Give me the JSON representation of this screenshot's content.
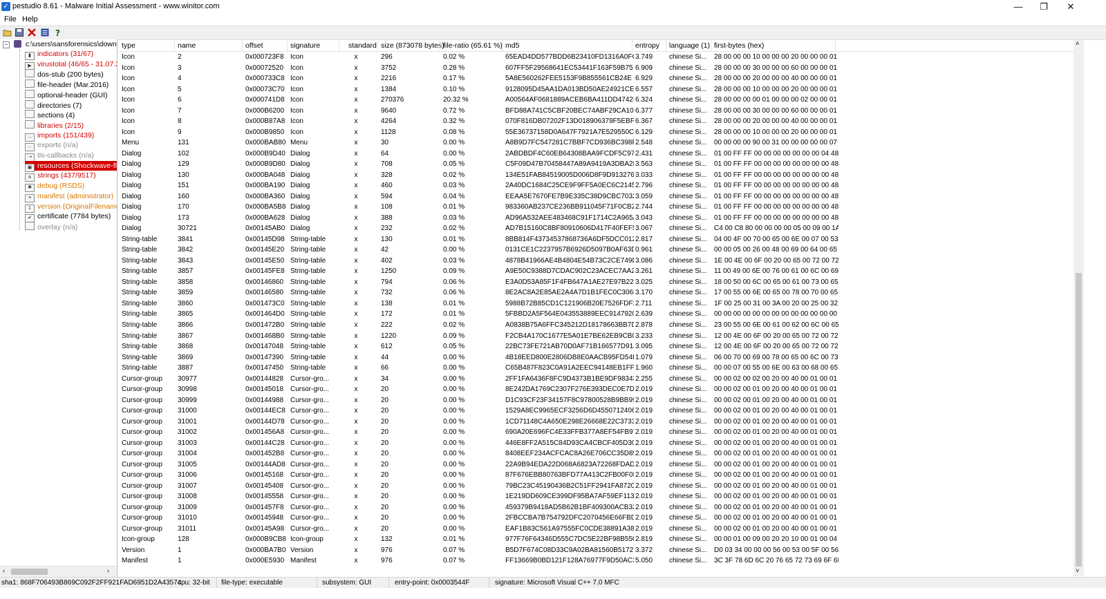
{
  "window": {
    "title": "pestudio 8.61 - Malware Initial Assessment - www.winitor.com",
    "minimize": "—",
    "restore": "❐",
    "close": "✕"
  },
  "menu": {
    "file": "File",
    "help": "Help"
  },
  "toolbar": {
    "open": "open-icon",
    "save": "save-icon",
    "delete": "delete-icon",
    "list": "list-icon",
    "help": "help-icon"
  },
  "tree": {
    "root": "c:\\users\\sansforensics\\downlo",
    "items": [
      {
        "label": "indicators (31/67)",
        "style": "red",
        "icon": "chart-icon"
      },
      {
        "label": "virustotal (46/65 - 31.07.20",
        "style": "red",
        "icon": "virustotal-icon"
      },
      {
        "label": "dos-stub (200 bytes)",
        "style": "normal",
        "icon": "box-icon"
      },
      {
        "label": "file-header (Mar.2016)",
        "style": "normal",
        "icon": "box-icon"
      },
      {
        "label": "optional-header (GUI)",
        "style": "normal",
        "icon": "box-icon"
      },
      {
        "label": "directories (7)",
        "style": "normal",
        "icon": "box-icon"
      },
      {
        "label": "sections (4)",
        "style": "normal",
        "icon": "box-icon"
      },
      {
        "label": "libraries (2/15)",
        "style": "red",
        "icon": "box-icon"
      },
      {
        "label": "imports (151/439)",
        "style": "red",
        "icon": "import-icon"
      },
      {
        "label": "exports (n/a)",
        "style": "gray",
        "icon": "export-icon"
      },
      {
        "label": "tls-callbacks (n/a)",
        "style": "gray",
        "icon": "callback-icon"
      },
      {
        "label": "resources (Shockwave-flas",
        "style": "selected",
        "icon": "resource-icon"
      },
      {
        "label": "strings (437/9517)",
        "style": "red",
        "icon": "strings-icon"
      },
      {
        "label": "debug (RSDS)",
        "style": "orange",
        "icon": "debug-icon"
      },
      {
        "label": "manifest (administrator)",
        "style": "orange",
        "icon": "manifest-icon"
      },
      {
        "label": "version (OriginalFilename)",
        "style": "orange",
        "icon": "version-icon"
      },
      {
        "label": "certificate (7784 bytes)",
        "style": "normal",
        "icon": "certificate-icon"
      },
      {
        "label": "overlay (n/a)",
        "style": "gray",
        "icon": "overlay-icon"
      }
    ]
  },
  "columns": [
    "type",
    "name",
    "offset",
    "signature",
    "standard",
    "size (873078 bytes)",
    "file-ratio (65.61 %)",
    "md5",
    "entropy",
    "language (1)",
    "first-bytes (hex)"
  ],
  "rows": [
    [
      "Icon",
      "2",
      "0x000723F8",
      "Icon",
      "x",
      "296",
      "0.02 %",
      "65EAD4DD577BDD6B23410FD1316A0FC9",
      "3.749",
      "chinese Si...",
      "28 00 00 00 10 00 00 00 20 00 00 00 01 ..."
    ],
    [
      "Icon",
      "3",
      "0x00072520",
      "Icon",
      "x",
      "3752",
      "0.28 %",
      "607FF5F29568641EC53441F163F59B75",
      "6.909",
      "chinese Si...",
      "28 00 00 00 30 00 00 00 60 00 00 00 01 ..."
    ],
    [
      "Icon",
      "4",
      "0x000733C8",
      "Icon",
      "x",
      "2216",
      "0.17 %",
      "5A8E560262FEE5153F9B855561CB24E",
      "6.929",
      "chinese Si...",
      "28 00 00 00 20 00 00 00 40 00 00 00 01 ..."
    ],
    [
      "Icon",
      "5",
      "0x00073C70",
      "Icon",
      "x",
      "1384",
      "0.10 %",
      "9128095D45AA1DA013BD50AE24921CE7",
      "6.557",
      "chinese Si...",
      "28 00 00 00 10 00 00 00 20 00 00 00 01 ..."
    ],
    [
      "Icon",
      "6",
      "0x000741D8",
      "Icon",
      "x",
      "270376",
      "20.32 %",
      "A00564AF0681889ACEB6BA411DD4742B",
      "6.324",
      "chinese Si...",
      "28 00 00 00 00 01 00 00 00 02 00 00 01 ..."
    ],
    [
      "Icon",
      "7",
      "0x000B6200",
      "Icon",
      "x",
      "9640",
      "0.72 %",
      "BFD88A741C5CBF20BEC74ABF29CA10D7",
      "6.377",
      "chinese Si...",
      "28 00 00 00 30 00 00 00 60 00 00 00 01 ..."
    ],
    [
      "Icon",
      "8",
      "0x000B87A8",
      "Icon",
      "x",
      "4264",
      "0.32 %",
      "070F816DB07202F13D018906379F5EBF",
      "6.367",
      "chinese Si...",
      "28 00 00 00 20 00 00 00 40 00 00 00 01 ..."
    ],
    [
      "Icon",
      "9",
      "0x000B9850",
      "Icon",
      "x",
      "1128",
      "0.08 %",
      "55E36737158D0A647F7921A7E529550C",
      "6.129",
      "chinese Si...",
      "28 00 00 00 10 00 00 00 20 00 00 00 01 ..."
    ],
    [
      "Menu",
      "131",
      "0x000BAB80",
      "Menu",
      "x",
      "30",
      "0.00 %",
      "A8B9D7FC547281C7BBF7CD936BC398F4",
      "2.548",
      "chinese Si...",
      "00 00 00 00 90 00 31 00 00 00 00 00 07 ..."
    ],
    [
      "Dialog",
      "102",
      "0x000B9D40",
      "Dialog",
      "x",
      "64",
      "0.00 %",
      "2ABDBDF4C60EB64308BAA9FCDF5C97FE",
      "2.431",
      "chinese Si...",
      "01 00 FF FF 00 00 00 00 00 00 00 04 48 ..."
    ],
    [
      "Dialog",
      "129",
      "0x000B9D80",
      "Dialog",
      "x",
      "708",
      "0.05 %",
      "C5F09D47B70458447A89A9419A3DBA2E",
      "3.563",
      "chinese Si...",
      "01 00 FF FF 00 00 00 00 00 00 00 00 48 ..."
    ],
    [
      "Dialog",
      "130",
      "0x000BA048",
      "Dialog",
      "x",
      "328",
      "0.02 %",
      "134E51FAB84519005D006D8F9D913276",
      "3.033",
      "chinese Si...",
      "01 00 FF FF 00 00 00 00 00 00 00 00 48 ..."
    ],
    [
      "Dialog",
      "151",
      "0x000BA190",
      "Dialog",
      "x",
      "460",
      "0.03 %",
      "2A40DC1684C25CE9F9FF5A0EC6C2145E",
      "2.796",
      "chinese Si...",
      "01 00 FF FF 00 00 00 00 00 00 00 00 48 ..."
    ],
    [
      "Dialog",
      "160",
      "0x000BA360",
      "Dialog",
      "x",
      "594",
      "0.04 %",
      "EEAA5E7670FE7B9E335C38D9CBC7032",
      "3.059",
      "chinese Si...",
      "01 00 FF FF 00 00 00 00 00 00 00 00 48 ..."
    ],
    [
      "Dialog",
      "170",
      "0x000BA5B8",
      "Dialog",
      "x",
      "108",
      "0.01 %",
      "983360AB237CE236BB911045F71F0CB2",
      "2.744",
      "chinese Si...",
      "01 00 FF FF 00 00 00 00 00 00 00 00 48 ..."
    ],
    [
      "Dialog",
      "173",
      "0x000BA628",
      "Dialog",
      "x",
      "388",
      "0.03 %",
      "AD96A532AEE483468C91F1714C2A965A",
      "3.043",
      "chinese Si...",
      "01 00 FF FF 00 00 00 00 00 00 00 00 48 ..."
    ],
    [
      "Dialog",
      "30721",
      "0x00145AB0",
      "Dialog",
      "x",
      "232",
      "0.02 %",
      "AD7B15160C8BF80910606D417F40FEF5",
      "3.067",
      "chinese Si...",
      "C4 00 C8 80 00 00 00 00 05 00 09 00 1A ..."
    ],
    [
      "String-table",
      "3841",
      "0x00145D98",
      "String-table",
      "x",
      "130",
      "0.01 %",
      "8BB814F43734537868736A6DF5DCC012",
      "2.817",
      "chinese Si...",
      "04 00 4F 00 70 00 65 00 6E 00 07 00 53 ..."
    ],
    [
      "String-table",
      "3842",
      "0x00145E20",
      "String-table",
      "x",
      "42",
      "0.00 %",
      "0131CE1C2237957B6926D5097B0AF63D",
      "0.961",
      "chinese Si...",
      "00 00 05 00 26 00 48 00 69 00 64 00 65 ..."
    ],
    [
      "String-table",
      "3843",
      "0x00145E50",
      "String-table",
      "x",
      "402",
      "0.03 %",
      "4878B41966AE4B4804E54B73C2CE749D",
      "3.086",
      "chinese Si...",
      "1E 00 4E 00 6F 00 20 00 65 00 72 00 72 ..."
    ],
    [
      "String-table",
      "3857",
      "0x00145FE8",
      "String-table",
      "x",
      "1250",
      "0.09 %",
      "A9E50C9388D7CDAC902C23ACEC7AA2...",
      "3.261",
      "chinese Si...",
      "11 00 49 00 6E 00 76 00 61 00 6C 00 69 ..."
    ],
    [
      "String-table",
      "3858",
      "0x00146860",
      "String-table",
      "x",
      "794",
      "0.06 %",
      "E3A0D53A85F1F4FB647A1AE27E97B22E",
      "3.025",
      "chinese Si...",
      "18 00 50 00 6C 00 65 00 61 00 73 00 65 ..."
    ],
    [
      "String-table",
      "3859",
      "0x00146580",
      "String-table",
      "x",
      "732",
      "0.06 %",
      "8E2AC8A2E85AE2A4A7D1B1FEC0C30687",
      "3.170",
      "chinese Si...",
      "17 00 55 00 6E 00 65 00 78 00 70 00 65 ..."
    ],
    [
      "String-table",
      "3860",
      "0x001473C0",
      "String-table",
      "x",
      "138",
      "0.01 %",
      "5988B72B85CD1C121906B20E7526FDF2",
      "2.711",
      "chinese Si...",
      "1F 00 25 00 31 00 3A 00 20 00 25 00 32 ..."
    ],
    [
      "String-table",
      "3865",
      "0x001464D0",
      "String-table",
      "x",
      "172",
      "0.01 %",
      "5FBBD2A5F564E043553889EEC9147920",
      "2.639",
      "chinese Si...",
      "00 00 00 00 00 00 00 00 00 00 00 00 00 ..."
    ],
    [
      "String-table",
      "3866",
      "0x001472B0",
      "String-table",
      "x",
      "222",
      "0.02 %",
      "A0838B75A6FFC345212D18178663BB7D",
      "2.878",
      "chinese Si...",
      "23 00 55 00 6E 00 61 00 62 00 6C 00 65 ..."
    ],
    [
      "String-table",
      "3867",
      "0x001468B0",
      "String-table",
      "x",
      "1220",
      "0.09 %",
      "F2CB4A170C1677E5A01E7BE62EB9CB0D",
      "3.233",
      "chinese Si...",
      "12 00 4E 00 6F 00 20 00 65 00 72 00 72 ..."
    ],
    [
      "String-table",
      "3868",
      "0x00147048",
      "String-table",
      "x",
      "612",
      "0.05 %",
      "22BC73FE721AB70D0AF71B166577D914",
      "3.095",
      "chinese Si...",
      "12 00 4E 00 6F 00 20 00 65 00 72 00 72 ..."
    ],
    [
      "String-table",
      "3869",
      "0x00147390",
      "String-table",
      "x",
      "44",
      "0.00 %",
      "4B18EED800E2806DB8E0AACB95FD54F2",
      "1.079",
      "chinese Si...",
      "06 00 70 00 69 00 78 00 65 00 6C 00 73 ..."
    ],
    [
      "String-table",
      "3887",
      "0x00147450",
      "String-table",
      "x",
      "66",
      "0.00 %",
      "C65B487F823C0A91A2EEC94148EB1FF6",
      "1.960",
      "chinese Si...",
      "00 00 07 00 55 00 6E 00 63 00 68 00 65 ..."
    ],
    [
      "Cursor-group",
      "30977",
      "0x00144828",
      "Cursor-gro...",
      "x",
      "34",
      "0.00 %",
      "2FF1FA6436F8FC9D4373B1BE9DF98343",
      "2.255",
      "chinese Si...",
      "00 00 02 00 02 00 20 00 40 00 01 00 01 ..."
    ],
    [
      "Cursor-group",
      "30998",
      "0x00145018",
      "Cursor-gro...",
      "x",
      "20",
      "0.00 %",
      "8E242DA1769C2307F276E393DEC0E7D9",
      "2.019",
      "chinese Si...",
      "00 00 02 00 01 00 20 00 40 00 01 00 01 ..."
    ],
    [
      "Cursor-group",
      "30999",
      "0x00144988",
      "Cursor-gro...",
      "x",
      "20",
      "0.00 %",
      "D1C93CF23F34157F8C97800528B9BB99",
      "2.019",
      "chinese Si...",
      "00 00 02 00 01 00 20 00 40 00 01 00 01 ..."
    ],
    [
      "Cursor-group",
      "31000",
      "0x00144EC8",
      "Cursor-gro...",
      "x",
      "20",
      "0.00 %",
      "1529A8EC9965ECF3256D6D4550712406",
      "2.019",
      "chinese Si...",
      "00 00 02 00 01 00 20 00 40 00 01 00 01 ..."
    ],
    [
      "Cursor-group",
      "31001",
      "0x00144D78",
      "Cursor-gro...",
      "x",
      "20",
      "0.00 %",
      "1CD71148C4A650E298E26668E22C3733",
      "2.019",
      "chinese Si...",
      "00 00 02 00 01 00 20 00 40 00 01 00 01 ..."
    ],
    [
      "Cursor-group",
      "31002",
      "0x001456A8",
      "Cursor-gro...",
      "x",
      "20",
      "0.00 %",
      "690A20E696FC4E33FFB377A8EF54FB97",
      "2.019",
      "chinese Si...",
      "00 00 02 00 01 00 20 00 40 00 01 00 01 ..."
    ],
    [
      "Cursor-group",
      "31003",
      "0x00144C28",
      "Cursor-gro...",
      "x",
      "20",
      "0.00 %",
      "446E8FF2A515C84D93CA4CBCF405D300",
      "2.019",
      "chinese Si...",
      "00 00 02 00 01 00 20 00 40 00 01 00 01 ..."
    ],
    [
      "Cursor-group",
      "31004",
      "0x001452B8",
      "Cursor-gro...",
      "x",
      "20",
      "0.00 %",
      "8408EEF234ACFCAC8A26E706CC35D85C",
      "2.019",
      "chinese Si...",
      "00 00 02 00 01 00 20 00 40 00 01 00 01 ..."
    ],
    [
      "Cursor-group",
      "31005",
      "0x00144AD8",
      "Cursor-gro...",
      "x",
      "20",
      "0.00 %",
      "22A9B94EDA22D068A6823A72268FDADA",
      "2.019",
      "chinese Si...",
      "00 00 02 00 01 00 20 00 40 00 01 00 01 ..."
    ],
    [
      "Cursor-group",
      "31006",
      "0x00145168",
      "Cursor-gro...",
      "x",
      "20",
      "0.00 %",
      "87F676EBB80763BFD77A413C2FB00F0D",
      "2.019",
      "chinese Si...",
      "00 00 02 00 01 00 20 00 40 00 01 00 01 ..."
    ],
    [
      "Cursor-group",
      "31007",
      "0x00145408",
      "Cursor-gro...",
      "x",
      "20",
      "0.00 %",
      "79BC23C45190436B2C51FF2941FA8720",
      "2.019",
      "chinese Si...",
      "00 00 02 00 01 00 20 00 40 00 01 00 01 ..."
    ],
    [
      "Cursor-group",
      "31008",
      "0x00145558",
      "Cursor-gro...",
      "x",
      "20",
      "0.00 %",
      "1E219DD609CE399DF95BA7AF59EF113F",
      "2.019",
      "chinese Si...",
      "00 00 02 00 01 00 20 00 40 00 01 00 01 ..."
    ],
    [
      "Cursor-group",
      "31009",
      "0x001457F8",
      "Cursor-gro...",
      "x",
      "20",
      "0.00 %",
      "459379B9418AD5B62B1BF409300ACB32",
      "2.019",
      "chinese Si...",
      "00 00 02 00 01 00 20 00 40 00 01 00 01 ..."
    ],
    [
      "Cursor-group",
      "31010",
      "0x00145948",
      "Cursor-gro...",
      "x",
      "20",
      "0.00 %",
      "2FBCCBA7B754792DFC2070456E66FBD7",
      "2.019",
      "chinese Si...",
      "00 00 02 00 01 00 20 00 40 00 01 00 01 ..."
    ],
    [
      "Cursor-group",
      "31011",
      "0x00145A98",
      "Cursor-gro...",
      "x",
      "20",
      "0.00 %",
      "EAF1B83C561A97555FC0CDE38891A389",
      "2.019",
      "chinese Si...",
      "00 00 02 00 01 00 20 00 40 00 01 00 01 ..."
    ],
    [
      "Icon-group",
      "128",
      "0x000B9CB8",
      "Icon-group",
      "x",
      "132",
      "0.01 %",
      "977F76F64346D555C7DC5E22BF98B550",
      "2.819",
      "chinese Si...",
      "00 00 01 00 09 00 20 20 10 00 01 00 04 ..."
    ],
    [
      "Version",
      "1",
      "0x000BA7B0",
      "Version",
      "x",
      "976",
      "0.07 %",
      "B5D7F674C08D33C9A02BA81560B51727",
      "3.372",
      "chinese Si...",
      "D0 03 34 00 00 00 56 00 53 00 5F 00 56 ..."
    ],
    [
      "Manifest",
      "1",
      "0x000E5930",
      "Manifest",
      "x",
      "976",
      "0.07 %",
      "FF13669B0BD121F128A76977F9D50AC3",
      "5.050",
      "chinese Si...",
      "3C 3F 78 6D 6C 20 76 65 72 73 69 6F 6E ..."
    ]
  ],
  "status": {
    "sha1": "sha1: 868F706493B869C092F2FF921FAD6951D2A43574",
    "cpu": "cpu: 32-bit",
    "filetype": "file-type: executable",
    "subsystem": "subsystem: GUI",
    "entry": "entry-point: 0x0003544F",
    "signature": "signature: Microsoft Visual C++ 7.0 MFC"
  },
  "colors": {
    "selected": "#d40000",
    "red": "#d40000",
    "orange": "#d77800",
    "gray": "#888888"
  }
}
